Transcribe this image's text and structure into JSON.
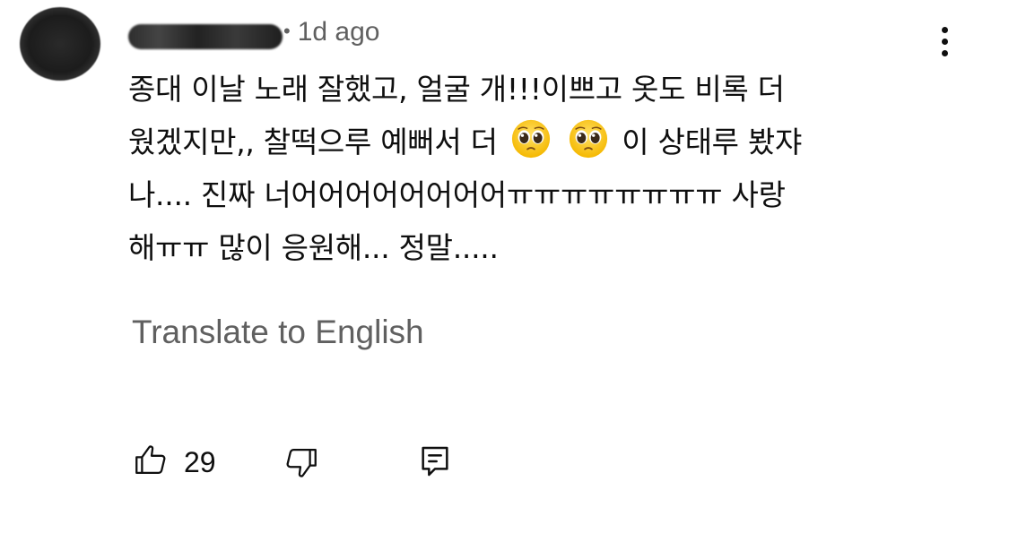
{
  "comment": {
    "time_ago": "1d ago",
    "text_lines": [
      "종대 이날 노래 잘했고, 얼굴 개!!!이쁘고 옷도 비록 더",
      "웠겠지만,, 찰떡으루 예뻐서 더",
      "이 상태루 봤쟈",
      "나.... 진짜 너어어어어어어어어ㅠㅠㅠㅠㅠㅠㅠㅠ 사랑",
      "해ㅠㅠ 많이 응원해... 정말....."
    ],
    "emoji": [
      "pleading-face-emoji",
      "pleading-face-emoji"
    ],
    "translate_label": "Translate to English"
  },
  "actions": {
    "like_count": "29",
    "icons": [
      "thumbs-up-icon",
      "thumbs-down-icon",
      "reply-icon"
    ]
  }
}
